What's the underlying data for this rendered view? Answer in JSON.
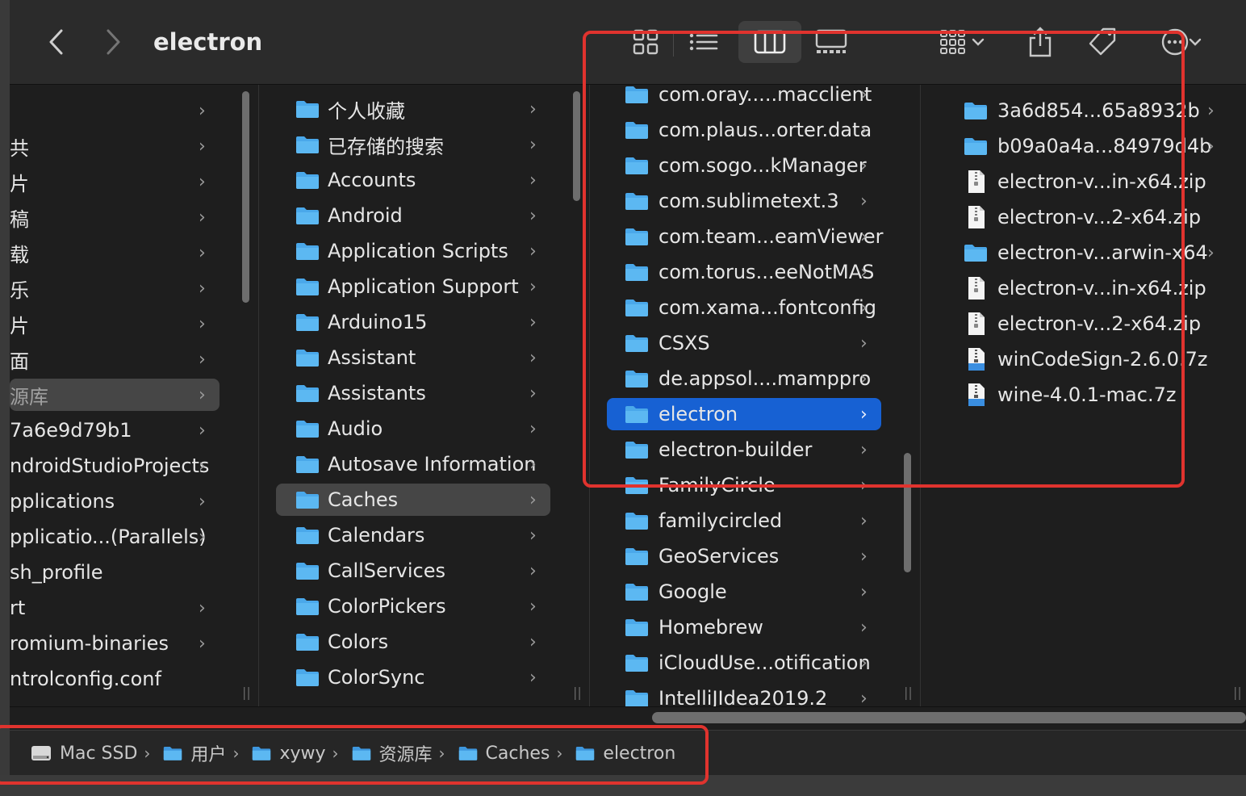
{
  "window": {
    "title": "electron"
  },
  "toolbar": {
    "back_icon": "chevron-left-icon",
    "forward_icon": "chevron-right-icon",
    "view_buttons": [
      "icon-view",
      "list-view",
      "column-view",
      "gallery-view"
    ],
    "active_view": "column-view",
    "actions": [
      "group-by",
      "share",
      "tag",
      "more"
    ]
  },
  "columns": {
    "col1": {
      "items": [
        {
          "label": "",
          "chevron": true
        },
        {
          "label": "共",
          "chevron": true
        },
        {
          "label": "片",
          "chevron": true
        },
        {
          "label": "稿",
          "chevron": true
        },
        {
          "label": "载",
          "chevron": true
        },
        {
          "label": "乐",
          "chevron": true
        },
        {
          "label": "片",
          "chevron": true
        },
        {
          "label": "面",
          "chevron": true
        },
        {
          "label": "源库",
          "chevron": true,
          "selected": "gray"
        },
        {
          "label": "7a6e9d79b1",
          "chevron": true
        },
        {
          "label": "ndroidStudioProjects",
          "chevron": true
        },
        {
          "label": "pplications",
          "chevron": true
        },
        {
          "label": "pplicatio...(Parallels)",
          "chevron": true
        },
        {
          "label": "sh_profile",
          "chevron": false
        },
        {
          "label": "rt",
          "chevron": true
        },
        {
          "label": "romium-binaries",
          "chevron": true
        },
        {
          "label": "ntrolconfig.conf",
          "chevron": false
        }
      ]
    },
    "col2": {
      "items": [
        {
          "label": "个人收藏",
          "chevron": true
        },
        {
          "label": "已存储的搜索",
          "chevron": true
        },
        {
          "label": "Accounts",
          "chevron": true
        },
        {
          "label": "Android",
          "chevron": true
        },
        {
          "label": "Application Scripts",
          "chevron": true
        },
        {
          "label": "Application Support",
          "chevron": true
        },
        {
          "label": "Arduino15",
          "chevron": true
        },
        {
          "label": "Assistant",
          "chevron": true
        },
        {
          "label": "Assistants",
          "chevron": true
        },
        {
          "label": "Audio",
          "chevron": true
        },
        {
          "label": "Autosave Information",
          "chevron": true
        },
        {
          "label": "Caches",
          "chevron": true,
          "selected": "gray"
        },
        {
          "label": "Calendars",
          "chevron": true
        },
        {
          "label": "CallServices",
          "chevron": true
        },
        {
          "label": "ColorPickers",
          "chevron": true
        },
        {
          "label": "Colors",
          "chevron": true
        },
        {
          "label": "ColorSync",
          "chevron": true
        }
      ]
    },
    "col3": {
      "items": [
        {
          "label": "com.oray.....macclient",
          "chevron": true
        },
        {
          "label": "com.plaus...orter.data",
          "chevron": true
        },
        {
          "label": "com.sogo...kManager",
          "chevron": true
        },
        {
          "label": "com.sublimetext.3",
          "chevron": true
        },
        {
          "label": "com.team...eamViewer",
          "chevron": true
        },
        {
          "label": "com.torus...eeNotMAS",
          "chevron": true
        },
        {
          "label": "com.xama...fontconfig",
          "chevron": true
        },
        {
          "label": "CSXS",
          "chevron": true
        },
        {
          "label": "de.appsol....mamppro",
          "chevron": true
        },
        {
          "label": "electron",
          "chevron": true,
          "selected": "blue"
        },
        {
          "label": "electron-builder",
          "chevron": true
        },
        {
          "label": "FamilyCircle",
          "chevron": true
        },
        {
          "label": "familycircled",
          "chevron": true
        },
        {
          "label": "GeoServices",
          "chevron": true
        },
        {
          "label": "Google",
          "chevron": true
        },
        {
          "label": "Homebrew",
          "chevron": true
        },
        {
          "label": "iCloudUse...otification",
          "chevron": true
        },
        {
          "label": "IntelliJIdea2019.2",
          "chevron": true
        }
      ]
    },
    "col4": {
      "items": [
        {
          "label": "3a6d854...65a8932b",
          "kind": "folder",
          "chevron": true
        },
        {
          "label": "b09a0a4a...84979d4b",
          "kind": "folder",
          "chevron": true
        },
        {
          "label": "electron-v...in-x64.zip",
          "kind": "zip",
          "chevron": false
        },
        {
          "label": "electron-v...2-x64.zip",
          "kind": "zip",
          "chevron": false
        },
        {
          "label": "electron-v...arwin-x64",
          "kind": "folder",
          "chevron": true
        },
        {
          "label": "electron-v...in-x64.zip",
          "kind": "zip",
          "chevron": false
        },
        {
          "label": "electron-v...2-x64.zip",
          "kind": "zip",
          "chevron": false
        },
        {
          "label": "winCodeSign-2.6.0.7z",
          "kind": "archive",
          "chevron": false
        },
        {
          "label": "wine-4.0.1-mac.7z",
          "kind": "archive",
          "chevron": false
        }
      ]
    }
  },
  "pathbar": {
    "crumbs": [
      {
        "label": "Mac SSD",
        "icon": "disk-icon"
      },
      {
        "label": "用户",
        "icon": "users-folder-icon"
      },
      {
        "label": "xywy",
        "icon": "home-folder-icon"
      },
      {
        "label": "资源库",
        "icon": "library-folder-icon"
      },
      {
        "label": "Caches",
        "icon": "folder-icon"
      },
      {
        "label": "electron",
        "icon": "folder-icon"
      }
    ]
  },
  "colors": {
    "folder_blue": "#4aa8ea",
    "selection_blue": "#1761d3",
    "selection_gray": "#464646",
    "annotation_red": "#e0332e"
  }
}
